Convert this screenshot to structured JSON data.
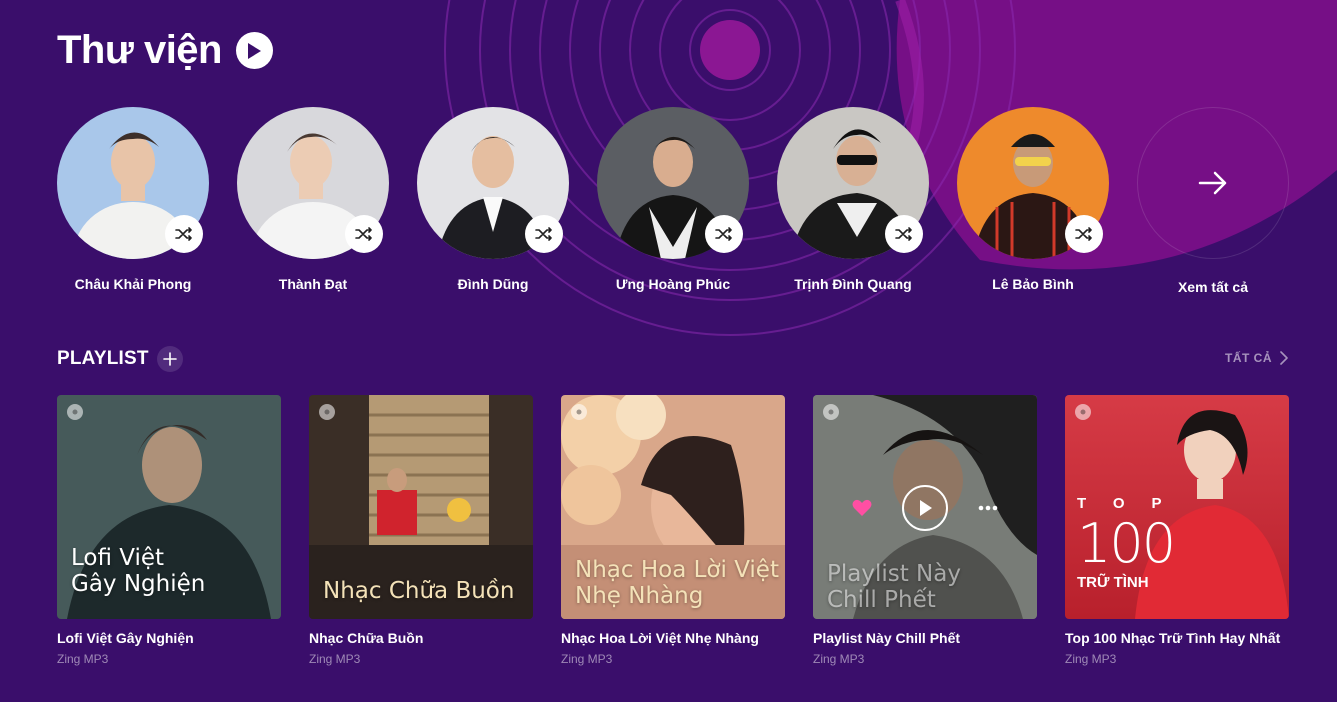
{
  "library": {
    "title": "Thư viện",
    "play_icon": "play-circle-icon",
    "see_all_label": "Xem tất cả",
    "artists": [
      {
        "name": "Châu Khải Phong",
        "bg": "#a9c7ea"
      },
      {
        "name": "Thành Đạt",
        "bg": "#d8d8dc"
      },
      {
        "name": "Đình Dũng",
        "bg": "#e3e3e6"
      },
      {
        "name": "Ưng Hoàng Phúc",
        "bg": "#5b5e63"
      },
      {
        "name": "Trịnh Đình Quang",
        "bg": "#c9c7c3"
      },
      {
        "name": "Lê Bảo Bình",
        "bg": "#ee8a2c"
      }
    ]
  },
  "playlists": {
    "title": "PLAYLIST",
    "view_all_label": "TẤT CẢ",
    "items": [
      {
        "title": "Lofi Việt Gây Nghiện",
        "owner": "Zing MP3",
        "cover_lines": [
          "Lofi Việt",
          "Gây Nghiện"
        ]
      },
      {
        "title": "Nhạc Chữa Buồn",
        "owner": "Zing MP3",
        "cover_lines": [
          "Nhạc Chữa Buồn"
        ]
      },
      {
        "title": "Nhạc Hoa Lời Việt Nhẹ Nhàng",
        "owner": "Zing MP3",
        "cover_lines": [
          "Nhạc Hoa Lời Việt",
          "Nhẹ Nhàng"
        ]
      },
      {
        "title": "Playlist Này Chill Phết",
        "owner": "Zing MP3",
        "cover_lines": [
          "Playlist Này",
          "Chill Phết"
        ]
      },
      {
        "title": "Top 100 Nhạc Trữ Tình Hay Nhất",
        "owner": "Zing MP3",
        "cover_top_letters": "TOP",
        "cover_number": "100",
        "cover_sub": "TRỮ TÌNH"
      }
    ]
  },
  "colors": {
    "background": "#3a0e6b",
    "accent_magenta": "#8a1088",
    "heart": "#ff4fa3"
  }
}
